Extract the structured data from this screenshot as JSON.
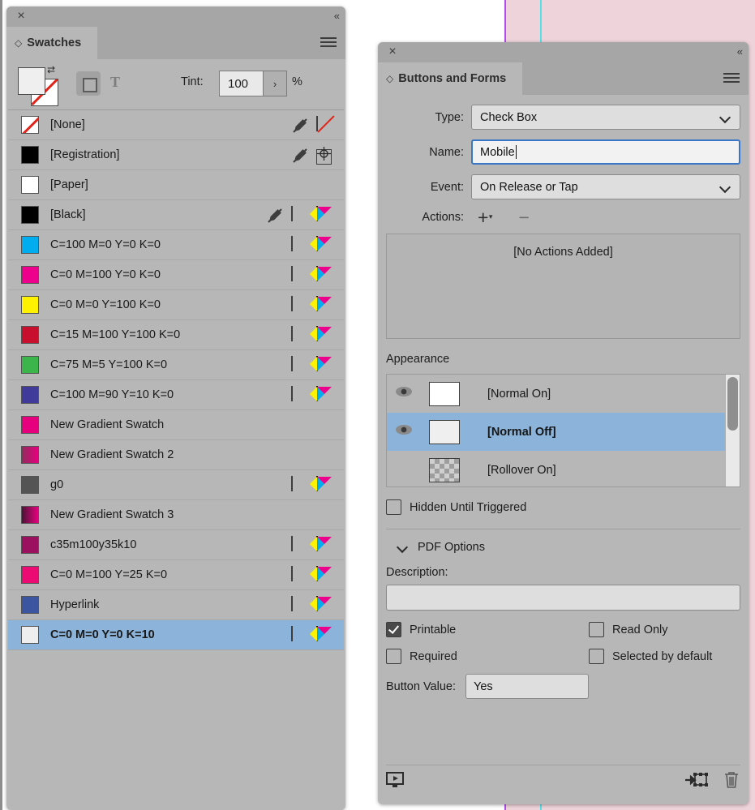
{
  "document_background": {
    "page_tint": "#efd3da",
    "guide_magenta": "#b14bf0",
    "guide_cyan": "#52e3e8"
  },
  "swatches_panel": {
    "title": "Swatches",
    "close_label": "×",
    "collapse_label": "«",
    "toolbar": {
      "tint_label": "Tint:",
      "tint_value": "100",
      "tint_caret": "›",
      "percent_label": "%",
      "text_format_label": "T"
    },
    "rows": [
      {
        "name": "[None]",
        "color": "#ffffff",
        "kind": "none",
        "icons": [
          "pen-slash",
          "none-box"
        ]
      },
      {
        "name": "[Registration]",
        "color": "#000000",
        "kind": "solid",
        "icons": [
          "pen-slash",
          "registration"
        ]
      },
      {
        "name": "[Paper]",
        "color": "#ffffff",
        "kind": "solid",
        "icons": []
      },
      {
        "name": "[Black]",
        "color": "#000000",
        "kind": "solid",
        "icons": [
          "pen-slash",
          "halftone",
          "cmyk"
        ]
      },
      {
        "name": "C=100 M=0 Y=0 K=0",
        "color": "#00aeef",
        "kind": "solid",
        "icons": [
          "halftone",
          "cmyk"
        ]
      },
      {
        "name": "C=0 M=100 Y=0 K=0",
        "color": "#ec008c",
        "kind": "solid",
        "icons": [
          "halftone",
          "cmyk"
        ]
      },
      {
        "name": "C=0 M=0 Y=100 K=0",
        "color": "#fff200",
        "kind": "solid",
        "icons": [
          "halftone",
          "cmyk"
        ]
      },
      {
        "name": "C=15 M=100 Y=100 K=0",
        "color": "#c8102e",
        "kind": "solid",
        "icons": [
          "halftone",
          "cmyk"
        ]
      },
      {
        "name": "C=75 M=5 Y=100 K=0",
        "color": "#3cb54a",
        "kind": "solid",
        "icons": [
          "halftone",
          "cmyk"
        ]
      },
      {
        "name": "C=100 M=90 Y=10 K=0",
        "color": "#403a9b",
        "kind": "solid",
        "icons": [
          "halftone",
          "cmyk"
        ]
      },
      {
        "name": "New Gradient Swatch",
        "color": "linear-gradient(90deg,#e6007e,#e6007e)",
        "kind": "gradient",
        "icons": []
      },
      {
        "name": "New Gradient Swatch 2",
        "color": "linear-gradient(90deg,#8e2e5c,#e6007e)",
        "kind": "gradient",
        "icons": []
      },
      {
        "name": "g0",
        "color": "#545454",
        "kind": "solid",
        "icons": [
          "halftone",
          "cmyk"
        ]
      },
      {
        "name": "New Gradient Swatch 3",
        "color": "linear-gradient(90deg,#4b1536,#e6007e)",
        "kind": "gradient",
        "icons": []
      },
      {
        "name": "c35m100y35k10",
        "color": "#9c1060",
        "kind": "solid",
        "icons": [
          "halftone",
          "cmyk"
        ]
      },
      {
        "name": "C=0 M=100 Y=25 K=0",
        "color": "#ec0b72",
        "kind": "solid",
        "icons": [
          "halftone",
          "cmyk"
        ]
      },
      {
        "name": "Hyperlink",
        "color": "#3b55a0",
        "kind": "solid",
        "icons": [
          "halftone",
          "cmyk"
        ]
      },
      {
        "name": "C=0 M=0 Y=0 K=10",
        "color": "#eeeeee",
        "kind": "solid",
        "icons": [
          "halftone",
          "cmyk"
        ],
        "selected": true
      }
    ]
  },
  "buttons_forms_panel": {
    "title": "Buttons and Forms",
    "close_label": "×",
    "collapse_label": "«",
    "type": {
      "label": "Type:",
      "value": "Check Box"
    },
    "name": {
      "label": "Name:",
      "value": "Mobile"
    },
    "event": {
      "label": "Event:",
      "value": "On Release or Tap"
    },
    "actions": {
      "label": "Actions:",
      "add": "+",
      "remove": "−",
      "empty_text": "[No Actions Added]"
    },
    "appearance": {
      "title": "Appearance",
      "states": [
        {
          "label": "[Normal On]",
          "visible": true,
          "thumb": "#ffffff",
          "selected": false
        },
        {
          "label": "[Normal Off]",
          "visible": true,
          "thumb": "#efefef",
          "selected": true
        },
        {
          "label": "[Rollover On]",
          "visible": false,
          "thumb": "checker",
          "selected": false
        }
      ]
    },
    "hidden_until_triggered": {
      "label": "Hidden Until Triggered",
      "checked": false
    },
    "pdf_options": {
      "title": "PDF Options",
      "description_label": "Description:",
      "description_value": "",
      "printable": {
        "label": "Printable",
        "checked": true
      },
      "read_only": {
        "label": "Read Only",
        "checked": false
      },
      "required": {
        "label": "Required",
        "checked": false
      },
      "selected_by_default": {
        "label": "Selected by default",
        "checked": false
      },
      "button_value": {
        "label": "Button Value:",
        "value": "Yes"
      }
    },
    "footer": {
      "preview": "preview-icon",
      "convert": "convert-to-button-icon",
      "delete": "trash-icon"
    }
  }
}
